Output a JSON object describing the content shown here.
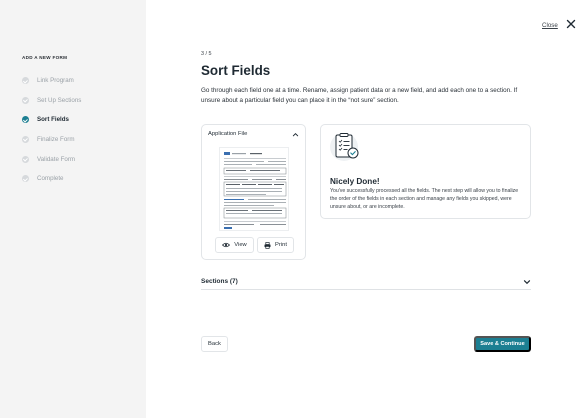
{
  "sidebar": {
    "title": "ADD A NEW FORM",
    "steps": [
      {
        "label": "Link Program",
        "state": "done"
      },
      {
        "label": "Set Up Sections",
        "state": "done"
      },
      {
        "label": "Sort Fields",
        "state": "active"
      },
      {
        "label": "Finalize Form",
        "state": "todo"
      },
      {
        "label": "Validate Form",
        "state": "todo"
      },
      {
        "label": "Complete",
        "state": "todo"
      }
    ]
  },
  "header": {
    "close_label": "Close",
    "close_icon": "close-icon"
  },
  "main": {
    "step_count": "3 / 5",
    "title": "Sort Fields",
    "description": "Go through each field one at a time. Rename, assign patient data or a new field, and add each one to a section. If unsure about a particular field you can place it in the “not sure” section."
  },
  "file_card": {
    "title": "Application File",
    "view_label": "View",
    "print_label": "Print"
  },
  "done_card": {
    "title": "Nicely Done!",
    "body": "You've successfully processed all the fields. The next step will allow you to finalize the order of the fields in each section and manage any fields you skipped, were unsure about, or are incomplete.",
    "icon": "document-check-icon"
  },
  "sections": {
    "label": "Sections (7)"
  },
  "footer": {
    "back_label": "Back",
    "save_label": "Save & Continue"
  },
  "colors": {
    "accent": "#1c7f92",
    "sidebar_bg": "#f4f4f4"
  }
}
